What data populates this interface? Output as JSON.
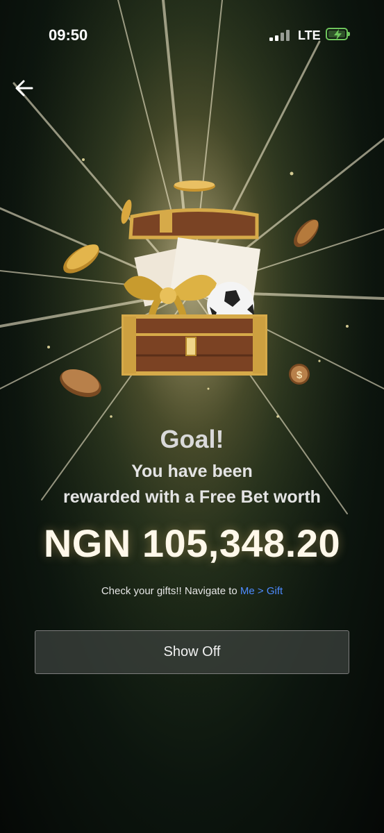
{
  "status_bar": {
    "time": "09:50",
    "network": "LTE",
    "battery_state": "charging"
  },
  "header": {
    "back_icon": "arrow-left-icon"
  },
  "reward": {
    "title": "Goal!",
    "line1": "You have been",
    "line2": "rewarded with a Free Bet worth",
    "amount": "NGN 105,348.20",
    "hint_prefix": "Check your gifts!! Navigate to ",
    "hint_link": "Me > Gift"
  },
  "actions": {
    "show_off_label": "Show Off"
  },
  "colors": {
    "accent_link": "#4d8bff",
    "gold": "#d4a938",
    "battery": "#6ec45c"
  }
}
